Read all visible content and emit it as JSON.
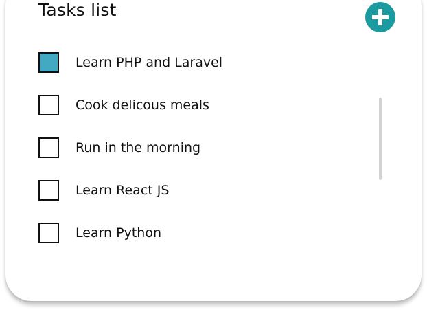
{
  "title": "Tasks list",
  "add_button": {
    "icon": "plus-circle-icon",
    "color": "#1b9ba0"
  },
  "tasks": [
    {
      "label": "Learn PHP and Laravel",
      "checked": true
    },
    {
      "label": "Cook delicous meals",
      "checked": false
    },
    {
      "label": "Run in the morning",
      "checked": false
    },
    {
      "label": "Learn React JS",
      "checked": false
    },
    {
      "label": "Learn Python",
      "checked": false
    }
  ],
  "colors": {
    "checked_fill": "#43a9c3",
    "accent": "#1b9ba0"
  }
}
